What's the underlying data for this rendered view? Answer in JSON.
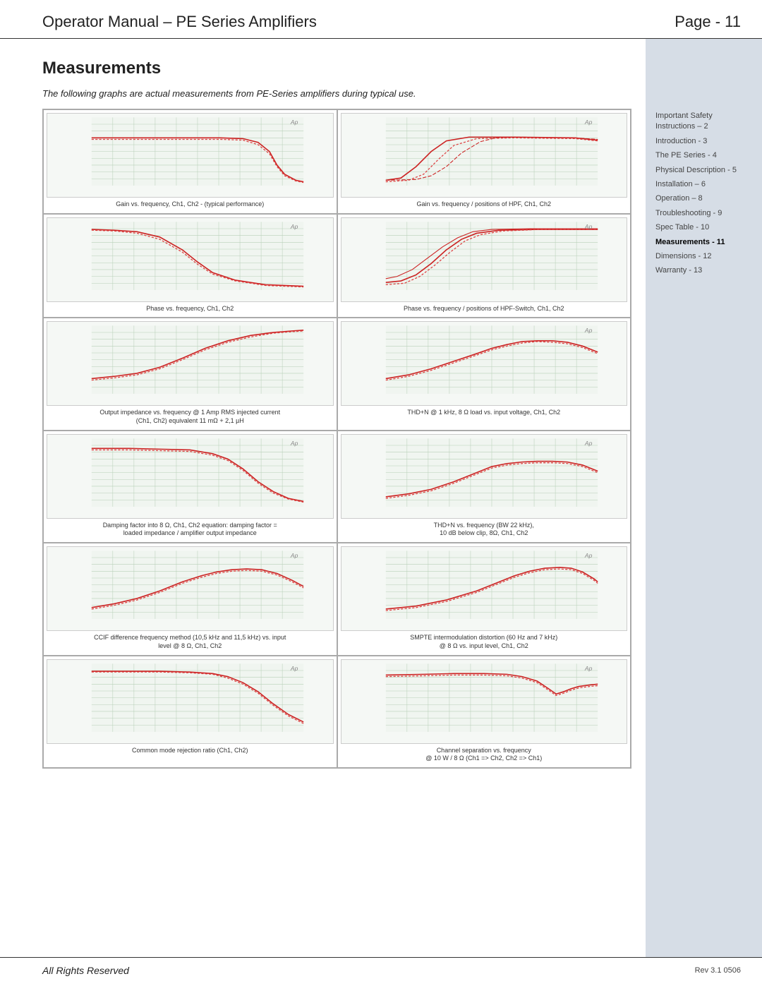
{
  "header": {
    "title": "Operator Manual – PE Series Amplifiers",
    "page": "Page - 11"
  },
  "section": {
    "title": "Measurements",
    "intro": "The following graphs are actual measurements from PE-Series amplifiers during typical use."
  },
  "graphs": [
    {
      "id": "graph1",
      "caption": "Gain vs. frequency, Ch1, Ch2 - (typical performance)"
    },
    {
      "id": "graph2",
      "caption": "Gain vs. frequency / positions of HPF, Ch1, Ch2"
    },
    {
      "id": "graph3",
      "caption": "Phase vs. frequency, Ch1, Ch2"
    },
    {
      "id": "graph4",
      "caption": "Phase vs. frequency / positions of HPF-Switch, Ch1, Ch2"
    },
    {
      "id": "graph5",
      "caption_line1": "Output impedance vs. frequency @ 1 Amp RMS injected current",
      "caption_line2": "(Ch1, Ch2) equivalent 11 mΩ + 2,1 µH"
    },
    {
      "id": "graph6",
      "caption": "THD+N @ 1 kHz, 8 Ω load vs. input voltage, Ch1, Ch2"
    },
    {
      "id": "graph7",
      "caption_line1": "Damping factor into 8 Ω, Ch1, Ch2 equation: damping factor =",
      "caption_line2": "loaded impedance / amplifier output impedance"
    },
    {
      "id": "graph8",
      "caption_line1": "THD+N vs. frequency (BW 22 kHz),",
      "caption_line2": "10 dB below clip, 8Ω, Ch1, Ch2"
    },
    {
      "id": "graph9",
      "caption_line1": "CCIF difference frequency method (10,5 kHz and 11,5 kHz) vs. input",
      "caption_line2": "level @ 8 Ω, Ch1, Ch2"
    },
    {
      "id": "graph10",
      "caption_line1": "SMPTE intermodulation distortion (60 Hz and 7 kHz)",
      "caption_line2": "@ 8 Ω vs. input level, Ch1, Ch2"
    },
    {
      "id": "graph11",
      "caption": "Common mode rejection ratio (Ch1, Ch2)"
    },
    {
      "id": "graph12",
      "caption_line1": "Channel separation vs. frequency",
      "caption_line2": "@ 10 W / 8 Ω (Ch1 => Ch2, Ch2 => Ch1)"
    }
  ],
  "sidebar": {
    "items": [
      {
        "label": "Important Safety Instructions – 2",
        "active": false
      },
      {
        "label": "Introduction - 3",
        "active": false
      },
      {
        "label": "The PE Series - 4",
        "active": false
      },
      {
        "label": "Physical Description - 5",
        "active": false
      },
      {
        "label": "Installation – 6",
        "active": false
      },
      {
        "label": "Operation – 8",
        "active": false
      },
      {
        "label": "Troubleshooting - 9",
        "active": false
      },
      {
        "label": "Spec Table - 10",
        "active": false
      },
      {
        "label": "Measurements - 11",
        "active": true
      },
      {
        "label": "Dimensions - 12",
        "active": false
      },
      {
        "label": "Warranty - 13",
        "active": false
      }
    ]
  },
  "footer": {
    "left": "All Rights Reserved",
    "right": "Rev 3.1  0506"
  }
}
